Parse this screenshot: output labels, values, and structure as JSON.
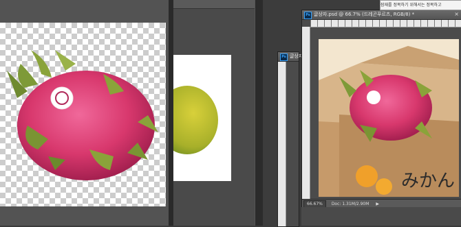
{
  "windows": {
    "front": {
      "title": "글상자.psd @ 66.7% (드레곤푸르츠, RGB/8) *",
      "zoom": "66.67%",
      "doc_info": "Doc: 1.31M/2.90M",
      "ps_badge": "Ps",
      "close_glyph": "×",
      "arrow_glyph": "▶",
      "box_text": "みかん"
    },
    "back": {
      "title": "글상자.",
      "ps_badge": "Ps"
    }
  },
  "tooltip": {
    "text": "잠재를 정복하기 위해서는 정복하고"
  },
  "colors": {
    "ps_blue": "#36a3ff",
    "dragonfruit_pink": "#e0457a",
    "leaf_green": "#8aa33a",
    "mango_yellow": "#c4c12a",
    "box_tan": "#c9a173",
    "orange": "#f0a02a"
  }
}
